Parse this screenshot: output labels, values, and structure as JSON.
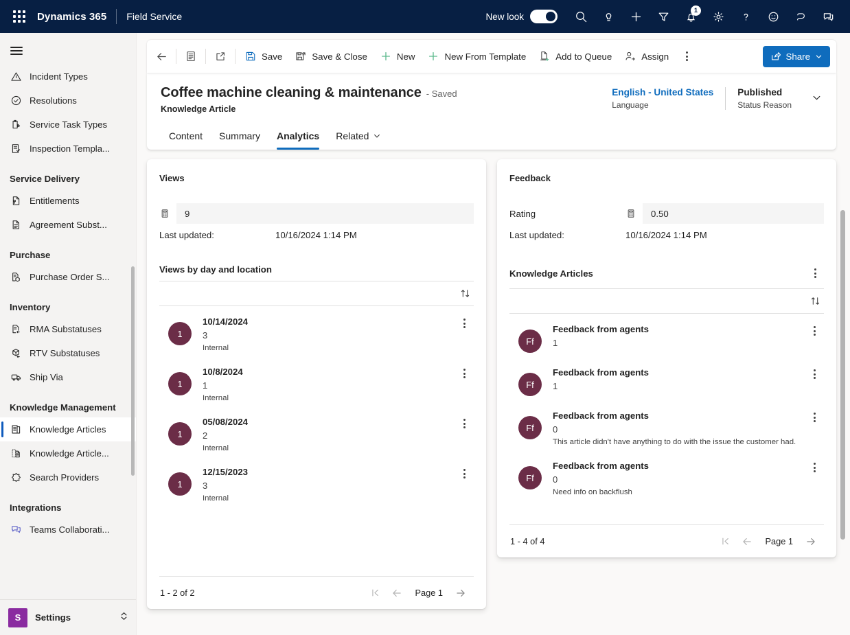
{
  "topbar": {
    "waffle_label": "app-launcher",
    "brand": "Dynamics 365",
    "app_name": "Field Service",
    "new_look_label": "New look",
    "new_look_on": true,
    "icons": [
      {
        "name": "search-icon",
        "label": "Search"
      },
      {
        "name": "lightbulb-icon",
        "label": "Insights"
      },
      {
        "name": "plus-icon",
        "label": "Quick create"
      },
      {
        "name": "filter-icon",
        "label": "Filter"
      },
      {
        "name": "bell-icon",
        "label": "Notifications",
        "badge": "1"
      },
      {
        "name": "gear-icon",
        "label": "Settings"
      },
      {
        "name": "question-icon",
        "label": "Help"
      },
      {
        "name": "smiley-icon",
        "label": "Feedback"
      },
      {
        "name": "copilot-icon",
        "label": "Copilot"
      },
      {
        "name": "teams-chat-icon",
        "label": "Teams chat"
      }
    ]
  },
  "sidebar": {
    "items": [
      {
        "label": "Incident Types",
        "icon": "warning-triangle-icon",
        "type": "item",
        "active": false
      },
      {
        "label": "Resolutions",
        "icon": "check-circle-icon",
        "type": "item",
        "active": false
      },
      {
        "label": "Service Task Types",
        "icon": "clipboard-pen-icon",
        "type": "item",
        "active": false
      },
      {
        "label": "Inspection Templa...",
        "icon": "checklist-icon",
        "type": "item",
        "active": false
      },
      {
        "label": "Service Delivery",
        "type": "group"
      },
      {
        "label": "Entitlements",
        "icon": "entitlement-doc-icon",
        "type": "item",
        "active": false
      },
      {
        "label": "Agreement Subst...",
        "icon": "document-lines-icon",
        "type": "item",
        "active": false
      },
      {
        "label": "Purchase",
        "type": "group"
      },
      {
        "label": "Purchase Order S...",
        "icon": "purchase-order-icon",
        "type": "item",
        "active": false
      },
      {
        "label": "Inventory",
        "type": "group"
      },
      {
        "label": "RMA Substatuses",
        "icon": "rma-doc-icon",
        "type": "item",
        "active": false
      },
      {
        "label": "RTV Substatuses",
        "icon": "rtv-box-icon",
        "type": "item",
        "active": false
      },
      {
        "label": "Ship Via",
        "icon": "truck-icon",
        "type": "item",
        "active": false
      },
      {
        "label": "Knowledge Management",
        "type": "group"
      },
      {
        "label": "Knowledge Articles",
        "icon": "knowledge-article-icon",
        "type": "item",
        "active": true
      },
      {
        "label": "Knowledge Article...",
        "icon": "knowledge-article-template-icon",
        "type": "item",
        "active": false
      },
      {
        "label": "Search Providers",
        "icon": "search-provider-icon",
        "type": "item",
        "active": false
      },
      {
        "label": "Integrations",
        "type": "group"
      },
      {
        "label": "Teams Collaborati...",
        "icon": "teams-icon",
        "type": "item",
        "active": false
      }
    ],
    "footer": {
      "initial": "S",
      "label": "Settings"
    }
  },
  "command_bar": {
    "back_label": "Back",
    "form_selector_label": "Form selector",
    "popout_label": "Open in new window",
    "buttons": [
      {
        "label": "Save",
        "icon": "save-icon"
      },
      {
        "label": "Save & Close",
        "icon": "save-close-icon"
      },
      {
        "label": "New",
        "icon": "plus-icon"
      },
      {
        "label": "New From Template",
        "icon": "plus-icon"
      },
      {
        "label": "Add to Queue",
        "icon": "add-queue-icon"
      },
      {
        "label": "Assign",
        "icon": "assign-user-icon"
      }
    ],
    "overflow_label": "More commands",
    "share_label": "Share"
  },
  "record": {
    "title": "Coffee machine cleaning & maintenance",
    "saved_state": "- Saved",
    "entity": "Knowledge Article",
    "language_value": "English - United States",
    "language_label": "Language",
    "status_value": "Published",
    "status_label": "Status Reason",
    "tabs": [
      {
        "label": "Content",
        "active": false,
        "has_chevron": false
      },
      {
        "label": "Summary",
        "active": false,
        "has_chevron": false
      },
      {
        "label": "Analytics",
        "active": true,
        "has_chevron": false
      },
      {
        "label": "Related",
        "active": false,
        "has_chevron": true
      }
    ]
  },
  "views_panel": {
    "title": "Views",
    "metric_label": "",
    "metric_value": "9",
    "last_updated_label": "Last updated:",
    "last_updated_value": "10/16/2024 1:14 PM",
    "subgrid_title": "Views by day and location",
    "sort_label": "Sort",
    "rows": [
      {
        "avatar": "1",
        "primary": "10/14/2024",
        "secondary": "3",
        "tertiary": "Internal"
      },
      {
        "avatar": "1",
        "primary": "10/8/2024",
        "secondary": "1",
        "tertiary": "Internal"
      },
      {
        "avatar": "1",
        "primary": "05/08/2024",
        "secondary": "2",
        "tertiary": "Internal"
      },
      {
        "avatar": "1",
        "primary": "12/15/2023",
        "secondary": "3",
        "tertiary": "Internal"
      }
    ],
    "pager_count": "1 - 2 of 2",
    "pager_page": "Page 1"
  },
  "feedback_panel": {
    "title": "Feedback",
    "metric_label": "Rating",
    "metric_value": "0.50",
    "last_updated_label": "Last updated:",
    "last_updated_value": "10/16/2024 1:14 PM",
    "subgrid_title": "Knowledge Articles",
    "subgrid_kebab_label": "More commands",
    "sort_label": "Sort",
    "rows": [
      {
        "avatar": "Ff",
        "primary": "Feedback from agents",
        "secondary": "1",
        "tertiary": ""
      },
      {
        "avatar": "Ff",
        "primary": "Feedback from agents",
        "secondary": "1",
        "tertiary": ""
      },
      {
        "avatar": "Ff",
        "primary": "Feedback from agents",
        "secondary": "0",
        "tertiary": "This article didn't have anything to do with the issue the customer had."
      },
      {
        "avatar": "Ff",
        "primary": "Feedback from agents",
        "secondary": "0",
        "tertiary": "Need info on backflush"
      }
    ],
    "pager_count": "1 - 4 of 4",
    "pager_page": "Page 1"
  },
  "colors": {
    "topbar_bg": "#071F43",
    "accent_blue": "#0f6cbd",
    "avatar_plum": "#6B2D47",
    "settings_purple": "#8A2BA0",
    "page_bg": "#faf9f8",
    "sidebar_bg": "#f4f3f2"
  }
}
